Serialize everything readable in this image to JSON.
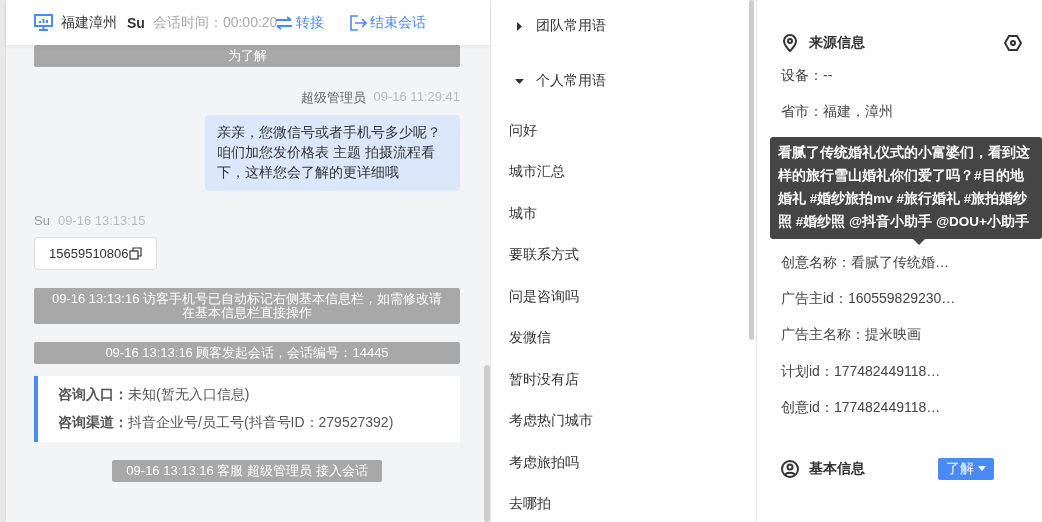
{
  "header": {
    "location": "福建漳州",
    "visitor": "Su",
    "duration_label": "会话时间：00:00:20",
    "actions": [
      {
        "kind": "transfer",
        "label": "转接"
      },
      {
        "kind": "end",
        "label": "结束会话"
      }
    ]
  },
  "chat": {
    "messages": [
      {
        "kind": "system",
        "text": "为了解"
      },
      {
        "kind": "agent",
        "name": "超级管理员",
        "time": "09-16 11:29:41",
        "text": "亲亲，您微信号或者手机号多少呢？咱们加您发价格表 主题 拍摄流程看下，这样您会了解的更详细哦"
      },
      {
        "kind": "visitor",
        "name": "Su",
        "time": "09-16 13:13:15",
        "text": "15659510806"
      },
      {
        "kind": "system",
        "text": "09-16 13:13:16 访客手机号已自动标记右侧基本信息栏，如需修改请在基本信息栏直接操作"
      },
      {
        "kind": "system",
        "text": "09-16 13:13:16 顾客发起会话，会话编号：14445"
      },
      {
        "kind": "info",
        "lines": [
          {
            "label": "咨询入口：",
            "value": "未知(暂无入口信息)"
          },
          {
            "label": "咨询渠道：",
            "value": "抖音企业号/员工号(抖音号ID：279527392)"
          }
        ]
      },
      {
        "kind": "system",
        "text": "09-16 13:13:16 客服 超级管理员 接入会话"
      }
    ]
  },
  "phrases": {
    "groups": [
      {
        "title": "团队常用语",
        "expanded": false
      },
      {
        "title": "个人常用语",
        "expanded": true,
        "items": [
          "问好",
          "城市汇总",
          "城市",
          "要联系方式",
          "问是咨询吗",
          "发微信",
          "暂时没有店",
          "考虑热门城市",
          "考虑旅拍吗",
          "去哪拍"
        ]
      }
    ]
  },
  "source_info": {
    "title": "来源信息",
    "rows_above": [
      "设备：--",
      "省市：福建，漳州"
    ],
    "rows_below": [
      "创意名称：看腻了传统婚…",
      "广告主id：160559829230…",
      "广告主名称：提米映画",
      "计划id：177482449118…",
      "创意id：177482449118…"
    ],
    "tooltip": "看腻了传统婚礼仪式的小富婆们，看到这样的旅行雪山婚礼你们爱了吗？#目的地婚礼 #婚纱旅拍mv #旅行婚礼 #旅拍婚纱照 #婚纱照 @抖音小助手 @DOU+小助手"
  },
  "basic_info": {
    "title": "基本信息",
    "tag": "了解"
  }
}
